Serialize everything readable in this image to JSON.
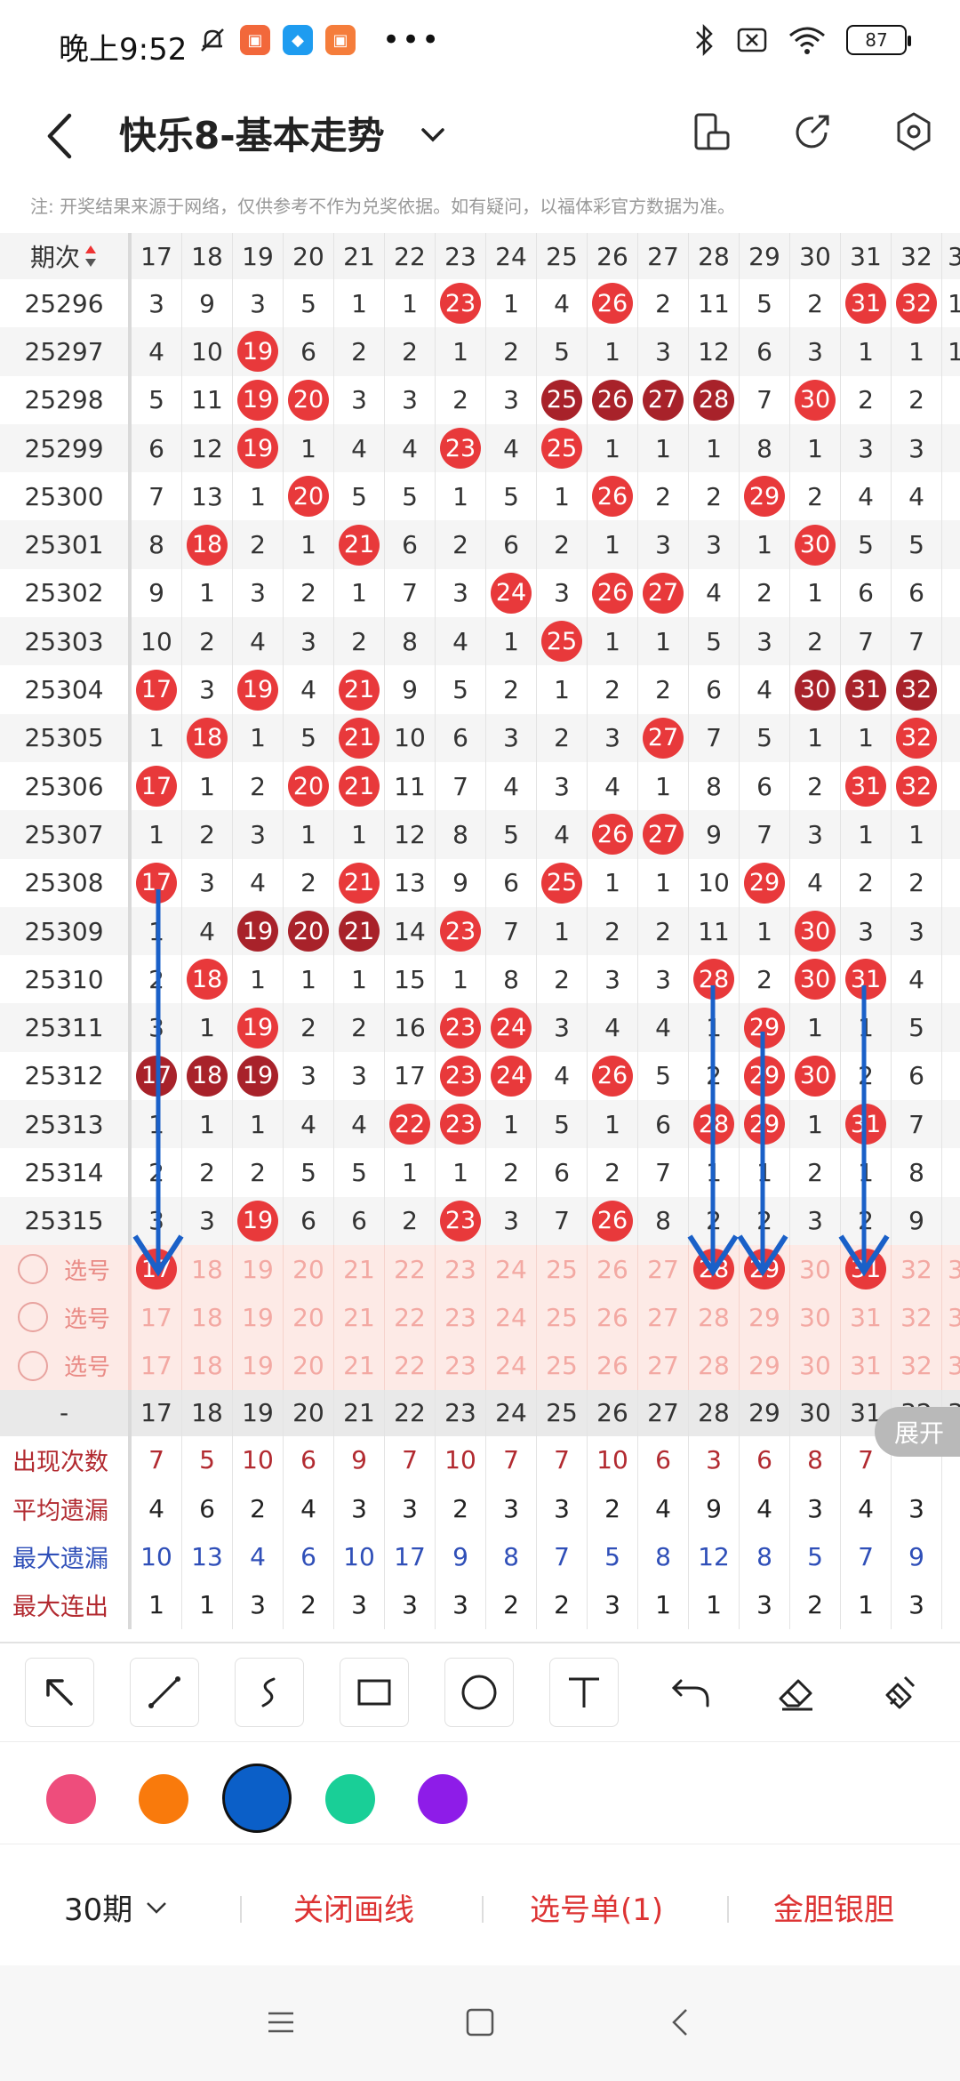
{
  "status": {
    "time": "晚上9:52",
    "dots": "•••",
    "battery": "87"
  },
  "title": {
    "text": "快乐8-基本走势"
  },
  "notice": "注: 开奖结果来源于网络，仅供参考不作为兑奖依据。如有疑问，以福体彩官方数据为准。",
  "grid": {
    "header_label": "期次",
    "columns": [
      "17",
      "18",
      "19",
      "20",
      "21",
      "22",
      "23",
      "24",
      "25",
      "26",
      "27",
      "28",
      "29",
      "30",
      "31",
      "32"
    ],
    "last_col_partial": "3",
    "rows": [
      {
        "period": "25296",
        "cells": [
          "3",
          "9",
          "3",
          "5",
          "1",
          "1",
          "23",
          "1",
          "4",
          "26",
          "2",
          "11",
          "5",
          "2",
          "31",
          "32"
        ],
        "balls": [
          "23",
          "26",
          "31",
          "32"
        ],
        "dark": [],
        "edge": "1"
      },
      {
        "period": "25297",
        "cells": [
          "4",
          "10",
          "19",
          "6",
          "2",
          "2",
          "1",
          "2",
          "5",
          "1",
          "3",
          "12",
          "6",
          "3",
          "1",
          "1"
        ],
        "balls": [
          "19"
        ],
        "dark": [],
        "edge": "1"
      },
      {
        "period": "25298",
        "cells": [
          "5",
          "11",
          "19",
          "20",
          "3",
          "3",
          "2",
          "3",
          "25",
          "26",
          "27",
          "28",
          "7",
          "30",
          "2",
          "2"
        ],
        "balls": [
          "19",
          "20",
          "30"
        ],
        "dark": [
          "25",
          "26",
          "27",
          "28"
        ],
        "edge": "●"
      },
      {
        "period": "25299",
        "cells": [
          "6",
          "12",
          "19",
          "1",
          "4",
          "4",
          "23",
          "4",
          "25",
          "1",
          "1",
          "1",
          "8",
          "1",
          "3",
          "3"
        ],
        "balls": [
          "19",
          "23",
          "25"
        ],
        "dark": [],
        "edge": ""
      },
      {
        "period": "25300",
        "cells": [
          "7",
          "13",
          "1",
          "20",
          "5",
          "5",
          "1",
          "5",
          "1",
          "26",
          "2",
          "2",
          "29",
          "2",
          "4",
          "4"
        ],
        "balls": [
          "20",
          "26",
          "29"
        ],
        "dark": [],
        "edge": ""
      },
      {
        "period": "25301",
        "cells": [
          "8",
          "18",
          "2",
          "1",
          "21",
          "6",
          "2",
          "6",
          "2",
          "1",
          "3",
          "3",
          "1",
          "30",
          "5",
          "5"
        ],
        "balls": [
          "18",
          "21",
          "30"
        ],
        "dark": [],
        "edge": "●"
      },
      {
        "period": "25302",
        "cells": [
          "9",
          "1",
          "3",
          "2",
          "1",
          "7",
          "3",
          "24",
          "3",
          "26",
          "27",
          "4",
          "2",
          "1",
          "6",
          "6"
        ],
        "balls": [
          "24",
          "26",
          "27"
        ],
        "dark": [],
        "edge": ""
      },
      {
        "period": "25303",
        "cells": [
          "10",
          "2",
          "4",
          "3",
          "2",
          "8",
          "4",
          "1",
          "25",
          "1",
          "1",
          "5",
          "3",
          "2",
          "7",
          "7"
        ],
        "balls": [
          "25"
        ],
        "dark": [],
        "edge": "●"
      },
      {
        "period": "25304",
        "cells": [
          "17",
          "3",
          "19",
          "4",
          "21",
          "9",
          "5",
          "2",
          "1",
          "2",
          "2",
          "6",
          "4",
          "30",
          "31",
          "32"
        ],
        "balls": [
          "17",
          "19",
          "21"
        ],
        "dark": [
          "30",
          "31",
          "32"
        ],
        "edge": "●"
      },
      {
        "period": "25305",
        "cells": [
          "1",
          "18",
          "1",
          "5",
          "21",
          "10",
          "6",
          "3",
          "2",
          "3",
          "27",
          "7",
          "5",
          "1",
          "1",
          "32"
        ],
        "balls": [
          "18",
          "21",
          "27",
          "32"
        ],
        "dark": [],
        "edge": ""
      },
      {
        "period": "25306",
        "cells": [
          "17",
          "1",
          "2",
          "20",
          "21",
          "11",
          "7",
          "4",
          "3",
          "4",
          "1",
          "8",
          "6",
          "2",
          "31",
          "32"
        ],
        "balls": [
          "17",
          "20",
          "21",
          "31",
          "32"
        ],
        "dark": [],
        "edge": ""
      },
      {
        "period": "25307",
        "cells": [
          "1",
          "2",
          "3",
          "1",
          "1",
          "12",
          "8",
          "5",
          "4",
          "26",
          "27",
          "9",
          "7",
          "3",
          "1",
          "1"
        ],
        "balls": [
          "26",
          "27"
        ],
        "dark": [],
        "edge": ""
      },
      {
        "period": "25308",
        "cells": [
          "17",
          "3",
          "4",
          "2",
          "21",
          "13",
          "9",
          "6",
          "25",
          "1",
          "1",
          "10",
          "29",
          "4",
          "2",
          "2"
        ],
        "balls": [
          "17",
          "21",
          "25",
          "29"
        ],
        "dark": [],
        "edge": ""
      },
      {
        "period": "25309",
        "cells": [
          "1",
          "4",
          "19",
          "20",
          "21",
          "14",
          "23",
          "7",
          "1",
          "2",
          "2",
          "11",
          "1",
          "30",
          "3",
          "3"
        ],
        "balls": [
          "23",
          "30"
        ],
        "dark": [
          "19",
          "20",
          "21"
        ],
        "edge": ""
      },
      {
        "period": "25310",
        "cells": [
          "2",
          "18",
          "1",
          "1",
          "1",
          "15",
          "1",
          "8",
          "2",
          "3",
          "3",
          "28",
          "2",
          "30",
          "31",
          "4"
        ],
        "balls": [
          "18",
          "28",
          "30",
          "31"
        ],
        "dark": [],
        "edge": ""
      },
      {
        "period": "25311",
        "cells": [
          "3",
          "1",
          "19",
          "2",
          "2",
          "16",
          "23",
          "24",
          "3",
          "4",
          "4",
          "1",
          "29",
          "1",
          "1",
          "5"
        ],
        "balls": [
          "19",
          "23",
          "24",
          "29"
        ],
        "dark": [],
        "edge": ""
      },
      {
        "period": "25312",
        "cells": [
          "17",
          "18",
          "19",
          "3",
          "3",
          "17",
          "23",
          "24",
          "4",
          "26",
          "5",
          "2",
          "29",
          "30",
          "2",
          "6"
        ],
        "balls": [
          "23",
          "24",
          "26",
          "29",
          "30"
        ],
        "dark": [
          "17",
          "18",
          "19"
        ],
        "edge": ""
      },
      {
        "period": "25313",
        "cells": [
          "1",
          "1",
          "1",
          "4",
          "4",
          "22",
          "23",
          "1",
          "5",
          "1",
          "6",
          "28",
          "29",
          "1",
          "31",
          "7"
        ],
        "balls": [
          "22",
          "23",
          "28",
          "29",
          "31"
        ],
        "dark": [],
        "edge": ""
      },
      {
        "period": "25314",
        "cells": [
          "2",
          "2",
          "2",
          "5",
          "5",
          "1",
          "1",
          "2",
          "6",
          "2",
          "7",
          "1",
          "1",
          "2",
          "1",
          "8"
        ],
        "balls": [],
        "dark": [],
        "edge": ""
      },
      {
        "period": "25315",
        "cells": [
          "3",
          "3",
          "19",
          "6",
          "6",
          "2",
          "23",
          "3",
          "7",
          "26",
          "8",
          "2",
          "2",
          "3",
          "2",
          "9"
        ],
        "balls": [
          "19",
          "23",
          "26"
        ],
        "dark": [],
        "edge": ""
      }
    ],
    "select_label": "选号",
    "selected_balls": [
      "17",
      "28",
      "29",
      "31"
    ],
    "summary_dash": "-",
    "summary_last": "3",
    "stats": [
      {
        "label": "出现次数",
        "values": [
          "7",
          "5",
          "10",
          "6",
          "9",
          "7",
          "10",
          "7",
          "7",
          "10",
          "6",
          "3",
          "6",
          "8",
          "7",
          ""
        ]
      },
      {
        "label": "平均遗漏",
        "values": [
          "4",
          "6",
          "2",
          "4",
          "3",
          "3",
          "2",
          "3",
          "3",
          "2",
          "4",
          "9",
          "4",
          "3",
          "4",
          "3"
        ]
      },
      {
        "label": "最大遗漏",
        "values": [
          "10",
          "13",
          "4",
          "6",
          "10",
          "17",
          "9",
          "8",
          "7",
          "5",
          "8",
          "12",
          "8",
          "5",
          "7",
          "9"
        ]
      },
      {
        "label": "最大连出",
        "values": [
          "1",
          "1",
          "3",
          "2",
          "3",
          "3",
          "3",
          "2",
          "2",
          "3",
          "1",
          "1",
          "3",
          "2",
          "1",
          "3"
        ]
      }
    ],
    "expand_label": "展开"
  },
  "colors": {
    "palette": [
      "#ee4d7c",
      "#f97a0c",
      "#0b5fc8",
      "#19cf97",
      "#8e1ce8"
    ],
    "selected": "#0b5fc8",
    "arrow": "#1a60c8"
  },
  "bottom": {
    "period": "30期",
    "close_lines": "关闭画线",
    "select_list": "选号单(1)",
    "gold": "金胆银胆"
  }
}
